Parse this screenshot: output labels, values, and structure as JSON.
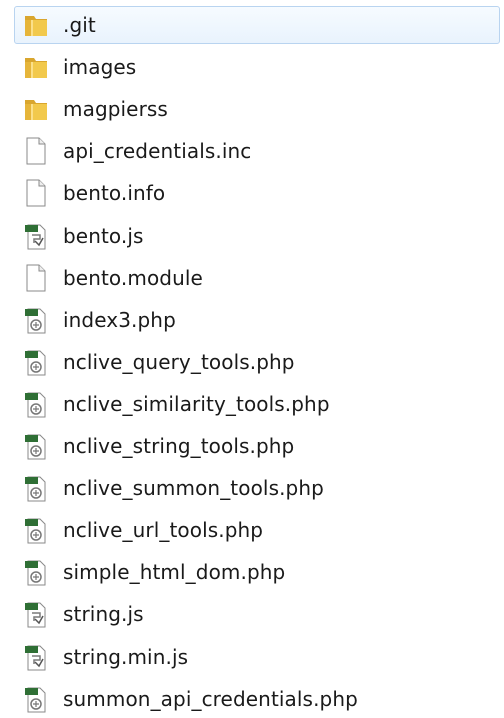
{
  "explorer": {
    "files": [
      {
        "name": ".git",
        "icon": "folder-icon",
        "selected": true
      },
      {
        "name": "images",
        "icon": "folder-icon"
      },
      {
        "name": "magpierss",
        "icon": "folder-icon"
      },
      {
        "name": "api_credentials.inc",
        "icon": "blank-file-icon"
      },
      {
        "name": "bento.info",
        "icon": "blank-file-icon"
      },
      {
        "name": "bento.js",
        "icon": "script-file-icon"
      },
      {
        "name": "bento.module",
        "icon": "blank-file-icon"
      },
      {
        "name": "index3.php",
        "icon": "php-file-icon"
      },
      {
        "name": "nclive_query_tools.php",
        "icon": "php-file-icon"
      },
      {
        "name": "nclive_similarity_tools.php",
        "icon": "php-file-icon"
      },
      {
        "name": "nclive_string_tools.php",
        "icon": "php-file-icon"
      },
      {
        "name": "nclive_summon_tools.php",
        "icon": "php-file-icon"
      },
      {
        "name": "nclive_url_tools.php",
        "icon": "php-file-icon"
      },
      {
        "name": "simple_html_dom.php",
        "icon": "php-file-icon"
      },
      {
        "name": "string.js",
        "icon": "script-file-icon"
      },
      {
        "name": "string.min.js",
        "icon": "script-file-icon"
      },
      {
        "name": "summon_api_credentials.php",
        "icon": "php-file-icon"
      }
    ]
  }
}
